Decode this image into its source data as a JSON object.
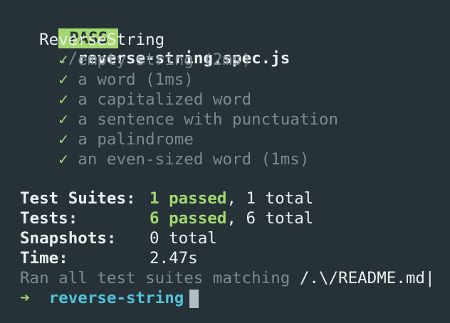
{
  "header": {
    "badge": "PASS",
    "file_dir": "./",
    "file_name": "reverse-string.spec.js"
  },
  "suite": {
    "name": "ReverseString",
    "check_glyph": "✓",
    "tests": [
      {
        "label": "empty string (2ms)"
      },
      {
        "label": "a word (1ms)"
      },
      {
        "label": "a capitalized word"
      },
      {
        "label": "a sentence with punctuation"
      },
      {
        "label": "a palindrome"
      },
      {
        "label": "an even-sized word (1ms)"
      }
    ]
  },
  "summary": {
    "suites_label": "Test Suites:",
    "suites_passed": "1 passed",
    "suites_total": ", 1 total",
    "tests_label": "Tests:",
    "tests_passed": "6 passed",
    "tests_total": ", 6 total",
    "snapshots_label": "Snapshots:",
    "snapshots_value": "0 total",
    "time_label": "Time:",
    "time_value": "2.47s",
    "ran_text": "Ran all test suites matching ",
    "ran_pattern": "/.\\/README.md|"
  },
  "prompt": {
    "arrow": "➜",
    "directory": "reverse-string"
  },
  "colors": {
    "background": "#263238",
    "pass_badge": "#a3d86f",
    "passed_text": "#a3d86f",
    "prompt_dir": "#4fc3d9",
    "dim_text": "#7c8a91"
  }
}
